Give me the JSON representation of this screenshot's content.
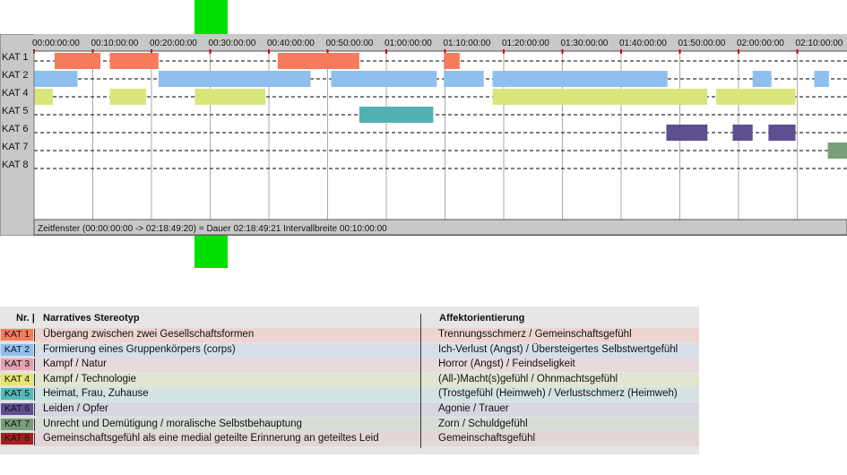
{
  "chart_data": {
    "type": "gantt",
    "x_unit": "minutes",
    "x_range": [
      0,
      138.82
    ],
    "interval_minutes": 10,
    "tick_labels": [
      "00:00:00:00",
      "00:10:00:00",
      "00:20:00:00",
      "00:30:00:00",
      "00:40:00:00",
      "00:50:00:00",
      "01:00:00:00",
      "01:10:00:00",
      "01:20:00:00",
      "01:30:00:00",
      "01:40:00:00",
      "01:50:00:00",
      "02:00:00:00",
      "02:10:00:00"
    ],
    "categories": [
      "KAT 1",
      "KAT 2",
      "KAT 4",
      "KAT 5",
      "KAT 6",
      "KAT 7",
      "KAT 8"
    ],
    "series": [
      {
        "name": "KAT 1",
        "color": "#f47c5c",
        "intervals": [
          [
            3.5,
            11.3
          ],
          [
            12.9,
            21.2
          ],
          [
            41.5,
            55.4
          ],
          [
            69.8,
            72.5
          ]
        ]
      },
      {
        "name": "KAT 2",
        "color": "#8fbfee",
        "intervals": [
          [
            0,
            7.4
          ],
          [
            21.2,
            47.1
          ],
          [
            50.6,
            68.6
          ],
          [
            69.8,
            76.6
          ],
          [
            78.1,
            107.9
          ],
          [
            122.4,
            125.6
          ],
          [
            132.9,
            135.4
          ]
        ]
      },
      {
        "name": "KAT 4",
        "color": "#d8e67c",
        "intervals": [
          [
            0,
            3.2
          ],
          [
            12.9,
            19.1
          ],
          [
            27.4,
            39.4
          ],
          [
            78.1,
            114.7
          ],
          [
            116.2,
            129.7
          ]
        ]
      },
      {
        "name": "KAT 5",
        "color": "#52b0b0",
        "intervals": [
          [
            55.4,
            68.0
          ]
        ]
      },
      {
        "name": "KAT 6",
        "color": "#5e4f8f",
        "intervals": [
          [
            107.7,
            114.7
          ],
          [
            119.0,
            122.4
          ],
          [
            125.1,
            129.7
          ]
        ]
      },
      {
        "name": "KAT 7",
        "color": "#7a9e78",
        "intervals": [
          [
            135.2,
            138.82
          ]
        ]
      },
      {
        "name": "KAT 8",
        "color": "#8b1a1a",
        "intervals": []
      }
    ],
    "status_text": "Zeitfenster (00:00:00:00 -> 02:18:49:20) = Dauer 02:18:49:21     Intervallbreite 00:10:00:00",
    "colors": {
      "panel": "#c8c8c8",
      "plot": "#ffffff",
      "tick_mark": "#cc0000",
      "grid": "#aaaaaa"
    }
  },
  "legend": {
    "headers": {
      "nr": "Nr. |",
      "narrative": "Narratives Stereotyp",
      "affect": "Affektorientierung"
    },
    "rows": [
      {
        "kat": "KAT 1",
        "color": "#f47c5c",
        "row_bg": "#ecd5cf",
        "narrative": "Übergang zwischen zwei Gesellschaftsformen",
        "affect": "Trennungsschmerz / Gemeinschaftsgefühl"
      },
      {
        "kat": "KAT 2",
        "color": "#8fbfee",
        "row_bg": "#d6dfe9",
        "narrative": "Formierung eines Gruppenkörpers (corps)",
        "affect": "Ich-Verlust (Angst) / Übersteigertes Selbstwertgefühl"
      },
      {
        "kat": "KAT 3",
        "color": "#e5a0b4",
        "row_bg": "#e6dadd",
        "narrative": "Kampf / Natur",
        "affect": "Horror (Angst) / Feindseligkeit"
      },
      {
        "kat": "KAT 4",
        "color": "#e6e66e",
        "row_bg": "#e3e5d3",
        "narrative": "Kampf / Technologie",
        "affect": "(All-)Macht(s)gefühl / Ohnmachtsgefühl"
      },
      {
        "kat": "KAT 5",
        "color": "#52b8b8",
        "row_bg": "#d3e2e2",
        "narrative": "Heimat, Frau, Zuhause",
        "affect": "(Trostgefühl (Heimweh) / Verlustschmerz (Heimweh)"
      },
      {
        "kat": "KAT 6",
        "color": "#5e4f8f",
        "row_bg": "#d8d6e0",
        "narrative": "Leiden / Opfer",
        "affect": "Agonie / Trauer"
      },
      {
        "kat": "KAT 7",
        "color": "#7a9e78",
        "row_bg": "#d7ded7",
        "narrative": "Unrecht und Demütigung / moralische Selbstbehauptung",
        "affect": "Zorn / Schuldgefühl"
      },
      {
        "kat": "KAT 8",
        "color": "#a32020",
        "row_bg": "#e4d6d6",
        "narrative": "Gemeinschaftsgefühl als eine medial geteilte Erinnerung an geteiltes Leid",
        "affect": "Gemeinschaftsgefühl"
      }
    ]
  }
}
